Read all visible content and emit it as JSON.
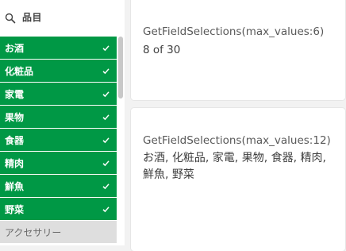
{
  "filter": {
    "title": "品目",
    "items": [
      {
        "label": "お酒",
        "selected": true
      },
      {
        "label": "化粧品",
        "selected": true
      },
      {
        "label": "家電",
        "selected": true
      },
      {
        "label": "果物",
        "selected": true
      },
      {
        "label": "食器",
        "selected": true
      },
      {
        "label": "精肉",
        "selected": true
      },
      {
        "label": "鮮魚",
        "selected": true
      },
      {
        "label": "野菜",
        "selected": true
      },
      {
        "label": "アクセサリー",
        "selected": false
      }
    ],
    "selected_color": "#009845",
    "alternative_color": "#dedede"
  },
  "kpi1": {
    "title": "GetFieldSelections(max_values:6)",
    "value": "8 of 30"
  },
  "kpi2": {
    "title": "GetFieldSelections(max_values:12)",
    "value": "お酒, 化粧品, 家電, 果物, 食器, 精肉, 鮮魚, 野菜"
  }
}
